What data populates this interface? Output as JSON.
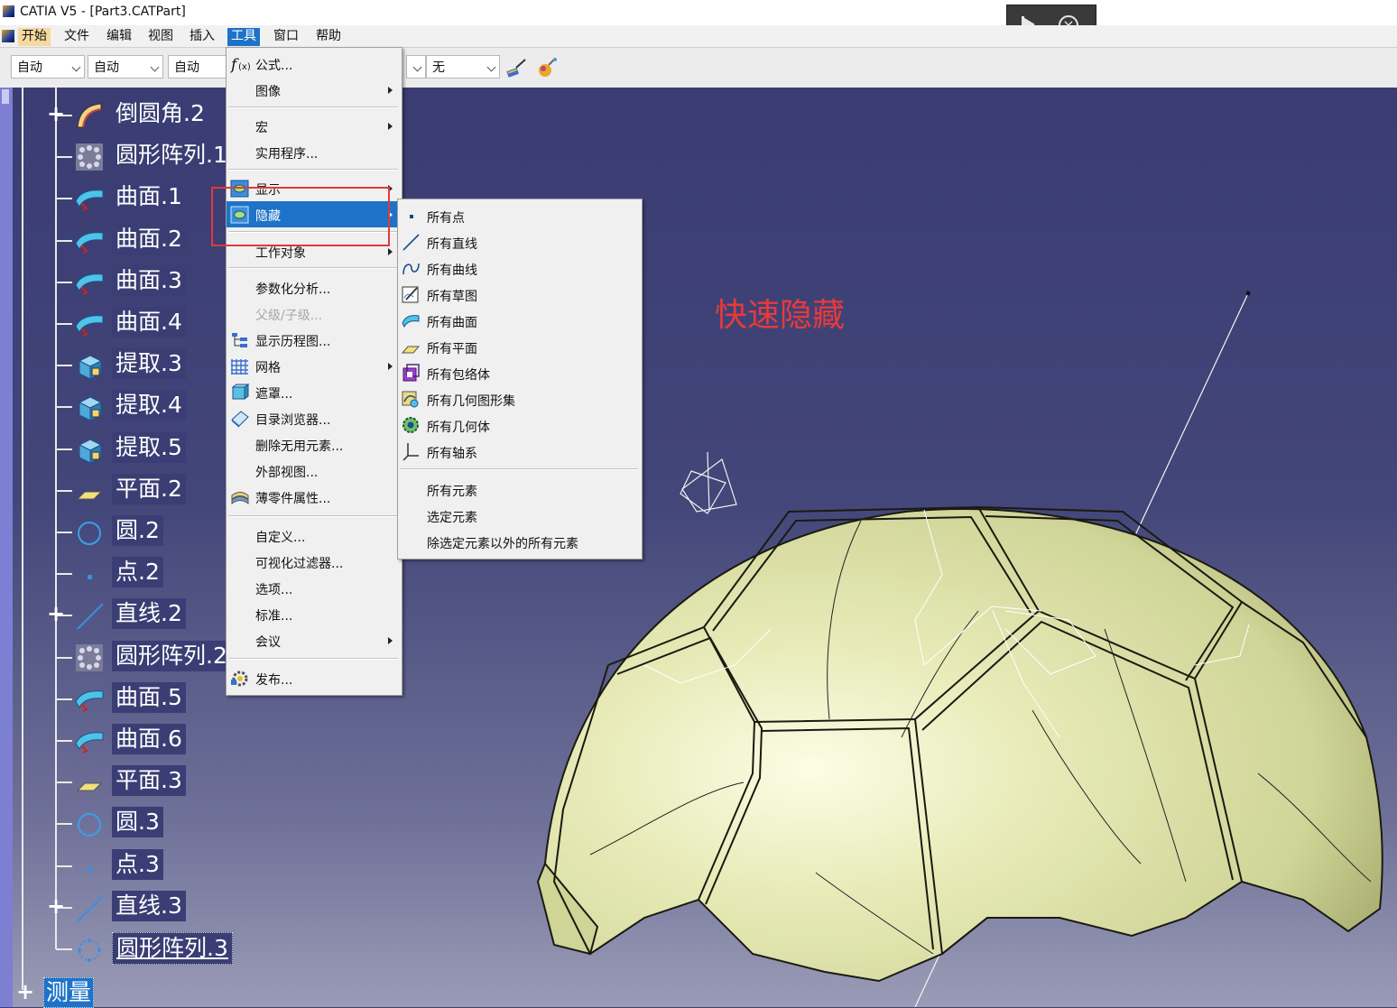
{
  "window": {
    "title": "CATIA V5 - [Part3.CATPart]"
  },
  "menubar": {
    "items": [
      {
        "label": "开始",
        "key": "start"
      },
      {
        "label": "文件",
        "key": "file"
      },
      {
        "label": "编辑",
        "key": "edit"
      },
      {
        "label": "视图",
        "key": "view"
      },
      {
        "label": "插入",
        "key": "insert"
      },
      {
        "label": "工具",
        "key": "tools"
      },
      {
        "label": "窗口",
        "key": "window"
      },
      {
        "label": "帮助",
        "key": "help"
      }
    ]
  },
  "toolbar": {
    "combo1": "自动",
    "combo2": "自动",
    "combo3": "自动",
    "combo4": "无"
  },
  "tree": {
    "items": [
      {
        "label": "倒圆角.2",
        "icon": "fillet-icon",
        "expandable": true
      },
      {
        "label": "圆形阵列.1",
        "icon": "circular-pattern-icon",
        "expandable": false
      },
      {
        "label": "曲面.1",
        "icon": "surface-icon",
        "expandable": false
      },
      {
        "label": "曲面.2",
        "icon": "surface-icon",
        "expandable": false
      },
      {
        "label": "曲面.3",
        "icon": "surface-icon",
        "expandable": false
      },
      {
        "label": "曲面.4",
        "icon": "surface-icon",
        "expandable": false
      },
      {
        "label": "提取.3",
        "icon": "extract-icon",
        "expandable": false
      },
      {
        "label": "提取.4",
        "icon": "extract-icon",
        "expandable": false
      },
      {
        "label": "提取.5",
        "icon": "extract-icon",
        "expandable": false
      },
      {
        "label": "平面.2",
        "icon": "plane-icon",
        "expandable": false
      },
      {
        "label": "圆.2",
        "icon": "circle-icon",
        "expandable": false
      },
      {
        "label": "点.2",
        "icon": "point-icon",
        "expandable": false
      },
      {
        "label": "直线.2",
        "icon": "line-icon",
        "expandable": true
      },
      {
        "label": "圆形阵列.2",
        "icon": "circular-pattern-icon",
        "expandable": false
      },
      {
        "label": "曲面.5",
        "icon": "surface-icon",
        "expandable": false
      },
      {
        "label": "曲面.6",
        "icon": "surface-icon",
        "expandable": false
      },
      {
        "label": "平面.3",
        "icon": "plane-icon",
        "expandable": false
      },
      {
        "label": "圆.3",
        "icon": "circle-icon",
        "expandable": false
      },
      {
        "label": "点.3",
        "icon": "point-icon",
        "expandable": false
      },
      {
        "label": "直线.3",
        "icon": "line-icon",
        "expandable": true
      },
      {
        "label": "圆形阵列.3",
        "icon": "circular-pattern-icon",
        "expandable": false
      }
    ],
    "measure": "测量"
  },
  "annotation": "快速隐藏",
  "tools_menu": {
    "items": [
      {
        "label": "公式...",
        "icon": "formula-icon",
        "submenu": false
      },
      {
        "label": "图像",
        "icon": "",
        "submenu": true
      },
      {
        "label": "宏",
        "icon": "",
        "submenu": true
      },
      {
        "label": "实用程序...",
        "icon": "",
        "submenu": false
      },
      {
        "label": "显示",
        "icon": "show-icon",
        "submenu": true
      },
      {
        "label": "隐藏",
        "icon": "hide-icon",
        "submenu": true
      },
      {
        "label": "工作对象",
        "icon": "",
        "submenu": true
      },
      {
        "label": "参数化分析...",
        "icon": "",
        "submenu": false
      },
      {
        "label": "父级/子级...",
        "icon": "",
        "submenu": false,
        "disabled": true
      },
      {
        "label": "显示历程图...",
        "icon": "history-icon",
        "submenu": false
      },
      {
        "label": "网格",
        "icon": "grid-icon",
        "submenu": true
      },
      {
        "label": "遮罩...",
        "icon": "mask-icon",
        "submenu": false
      },
      {
        "label": "目录浏览器...",
        "icon": "catalog-icon",
        "submenu": false
      },
      {
        "label": "删除无用元素...",
        "icon": "",
        "submenu": false
      },
      {
        "label": "外部视图...",
        "icon": "",
        "submenu": false
      },
      {
        "label": "薄零件属性...",
        "icon": "thin-part-icon",
        "submenu": false
      },
      {
        "label": "自定义...",
        "icon": "",
        "submenu": false
      },
      {
        "label": "可视化过滤器...",
        "icon": "",
        "submenu": false
      },
      {
        "label": "选项...",
        "icon": "",
        "submenu": false
      },
      {
        "label": "标准...",
        "icon": "",
        "submenu": false
      },
      {
        "label": "会议",
        "icon": "",
        "submenu": true
      },
      {
        "label": "发布...",
        "icon": "publish-icon",
        "submenu": false
      }
    ]
  },
  "hide_submenu": {
    "items": [
      {
        "label": "所有点",
        "icon": "point-icon"
      },
      {
        "label": "所有直线",
        "icon": "line-icon"
      },
      {
        "label": "所有曲线",
        "icon": "curve-icon"
      },
      {
        "label": "所有草图",
        "icon": "sketch-icon"
      },
      {
        "label": "所有曲面",
        "icon": "surface-icon"
      },
      {
        "label": "所有平面",
        "icon": "plane-icon"
      },
      {
        "label": "所有包络体",
        "icon": "volume-icon"
      },
      {
        "label": "所有几何图形集",
        "icon": "geometrical-set-icon"
      },
      {
        "label": "所有几何体",
        "icon": "body-icon"
      },
      {
        "label": "所有轴系",
        "icon": "axis-system-icon"
      },
      {
        "label": "所有元素",
        "icon": ""
      },
      {
        "label": "选定元素",
        "icon": ""
      },
      {
        "label": "除选定元素以外的所有元素",
        "icon": ""
      }
    ]
  },
  "colors": {
    "accent": "#1e73c8",
    "viewport_bg": "#3d3f72",
    "annotation": "#e83a3a",
    "model_surface": "#e6e9b4"
  }
}
